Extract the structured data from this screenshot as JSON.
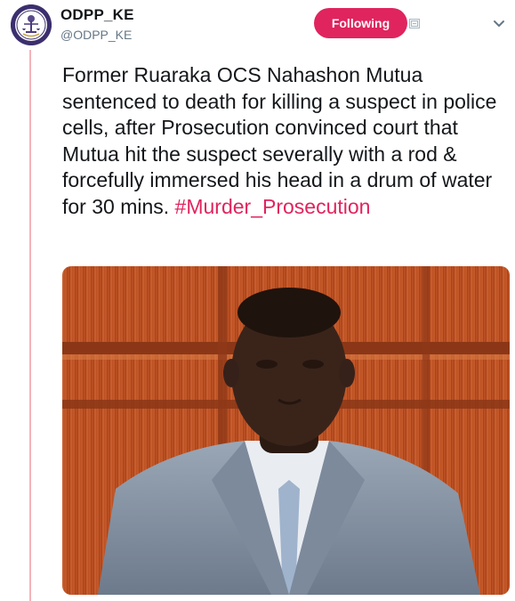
{
  "tweet": {
    "display_name": "ODPP_KE",
    "handle": "@ODPP_KE",
    "follow_label": "Following",
    "text": "Former Ruaraka OCS Nahashon Mutua sentenced to death for killing a suspect in police cells, after Prosecution convinced court that Mutua hit the suspect severally with a rod & forcefully immersed his head in a drum of water for 30 mins.",
    "hashtag": "#Murder_Prosecution",
    "icons": {
      "avatar": "odpp-logo-icon",
      "notify": "notification-settings-icon",
      "menu": "chevron-down-icon"
    },
    "colors": {
      "follow_button": "#e0245e",
      "hashtag": "#e0245e",
      "thread_line": "#f4b3b9",
      "handle": "#657786"
    }
  }
}
